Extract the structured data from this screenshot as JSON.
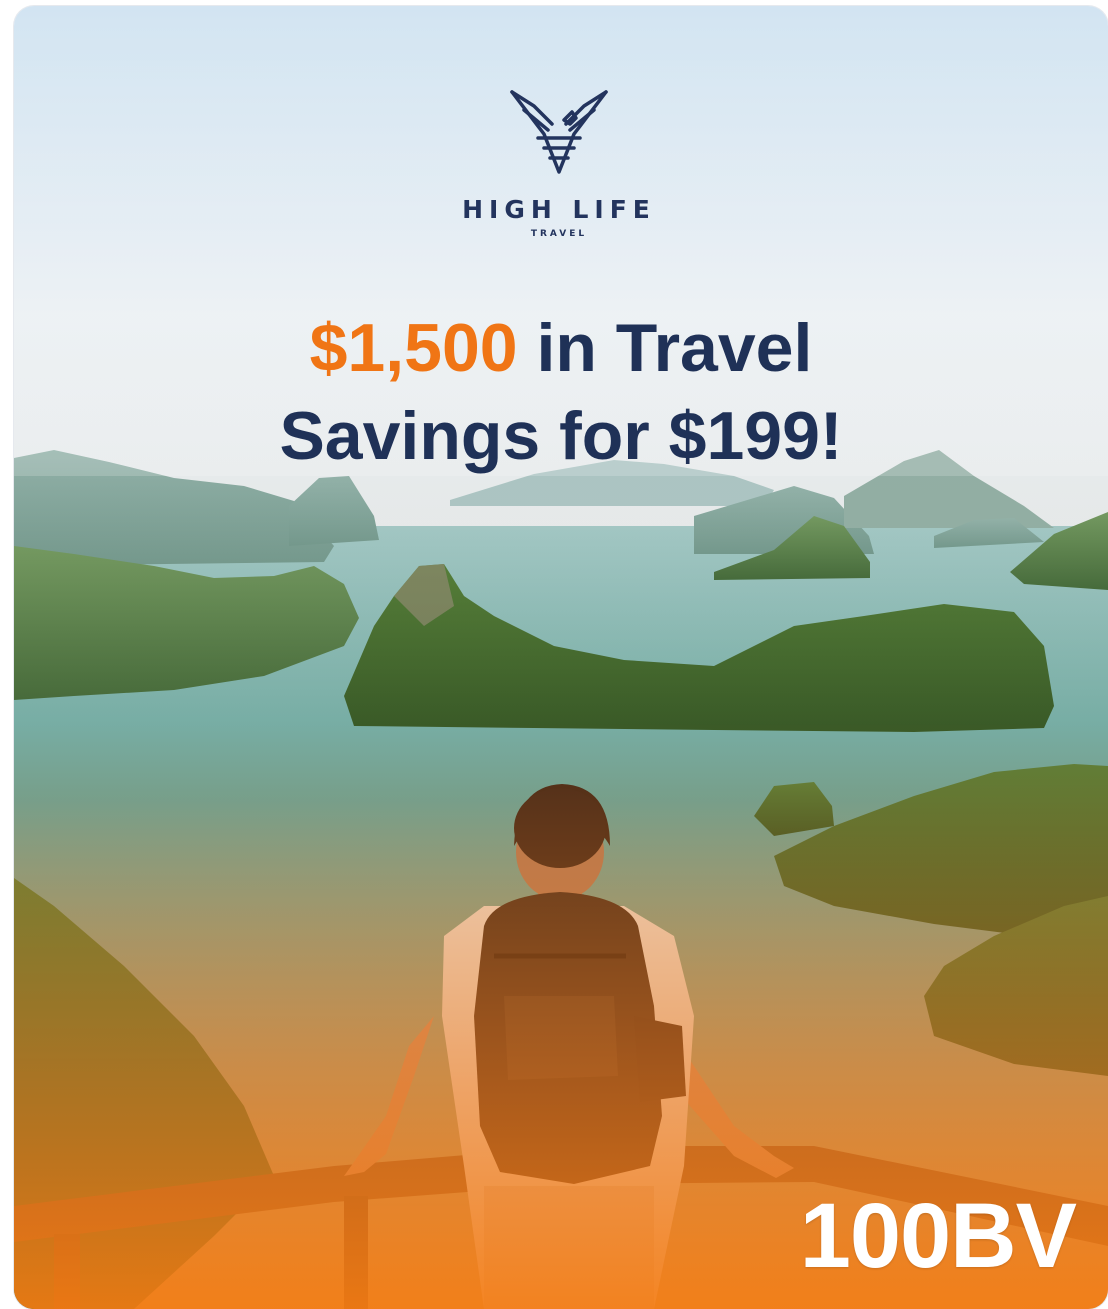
{
  "brand": {
    "name": "HIGH LIFE",
    "sub": "TRAVEL"
  },
  "headline": {
    "accent": "$1,500",
    "line1_rest": " in Travel",
    "line2": "Savings for $199!"
  },
  "badge": {
    "label": "100BV"
  },
  "colors": {
    "accent": "#f07515",
    "navy": "#1f3157",
    "overlay_orange": "#f07a1c"
  }
}
